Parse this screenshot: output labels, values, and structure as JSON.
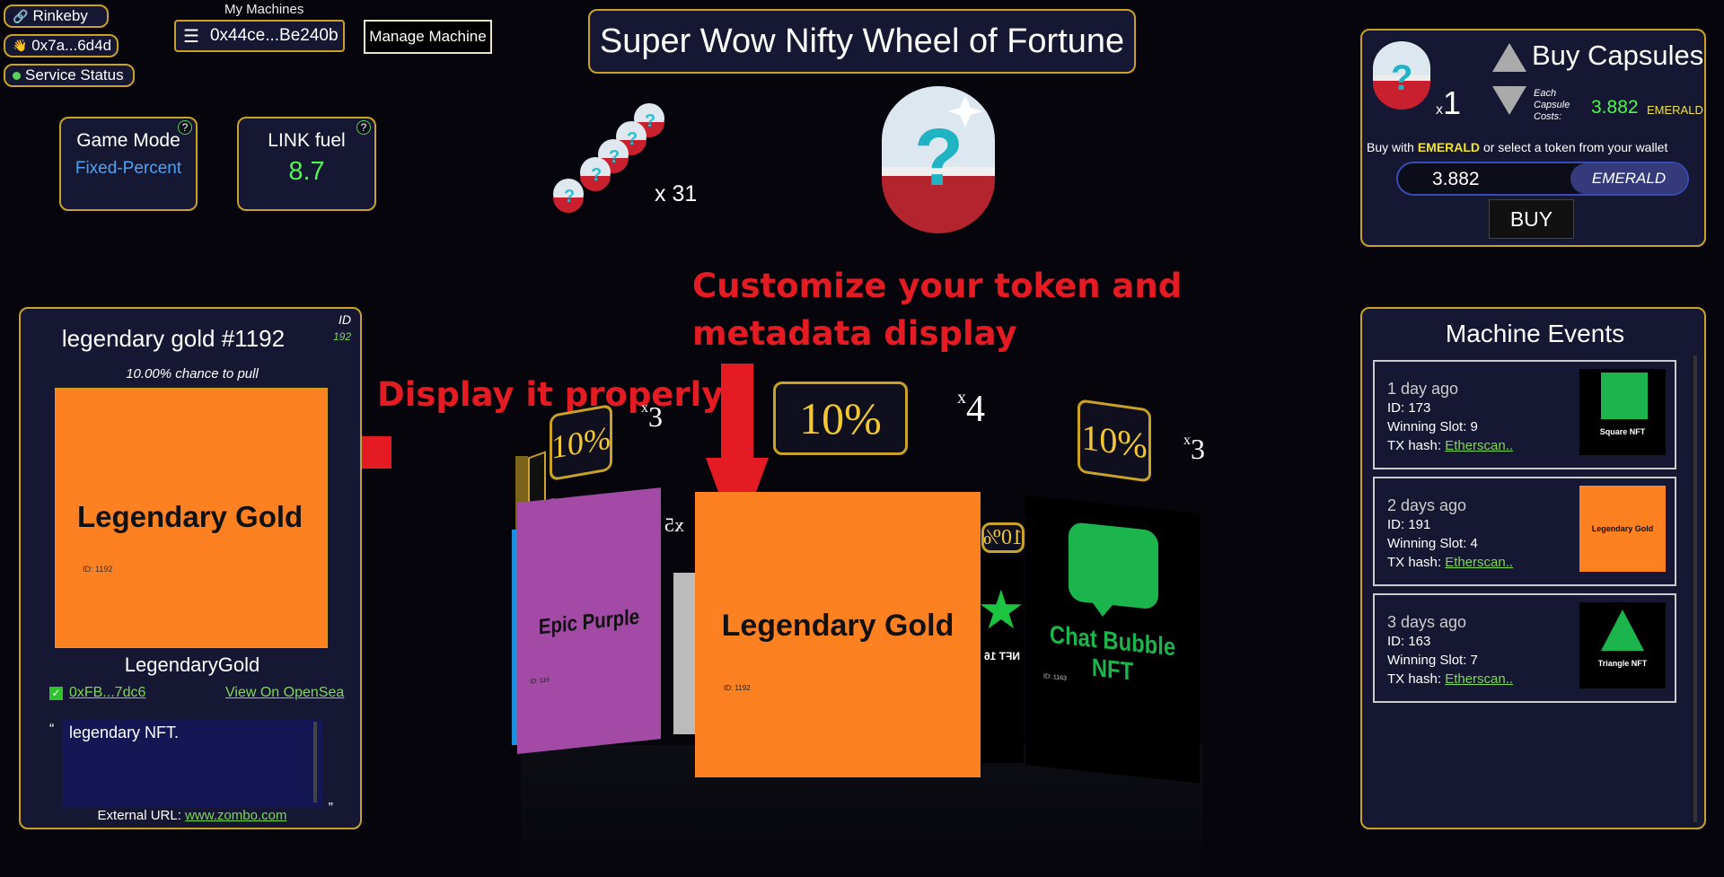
{
  "status": {
    "network": "Rinkeby",
    "wallet": "0x7a...6d4d",
    "service": "Service Status"
  },
  "machines": {
    "caption": "My Machines",
    "selected": "0x44ce...Be240b",
    "manage_label": "Manage Machine"
  },
  "title": "Super Wow Nifty Wheel of Fortune",
  "game_mode": {
    "label": "Game Mode",
    "value": "Fixed-Percent",
    "help": "?"
  },
  "link_fuel": {
    "label": "LINK fuel",
    "value": "8.7",
    "help": "?"
  },
  "capsules_owned": {
    "count": "x 31"
  },
  "annotations": {
    "customize_line1": "Customize your token and",
    "customize_line2": "metadata display",
    "display": "Display it properly!"
  },
  "token_panel": {
    "name": "legendary gold #1192",
    "id_label": "ID",
    "id_value": "192",
    "chance": "10.00% chance to pull",
    "image_title": "Legendary Gold",
    "image_id": "ID: 1192",
    "collection": "LegendaryGold",
    "contract": "0xFB...7dc6",
    "opensea": "View On OpenSea",
    "description": "legendary NFT.",
    "external_label": "External URL:",
    "external_url": "www.zombo.com"
  },
  "wheel": {
    "slots": [
      {
        "percent": "10%",
        "multiplier": "3",
        "title": "Epic Purple",
        "id": "ID: 116"
      },
      {
        "percent": "10%",
        "multiplier": "4",
        "title": "Legendary Gold",
        "id": "ID: 1192"
      },
      {
        "percent": "10%",
        "multiplier": "3",
        "title": "Chat Bubble NFT",
        "id": "ID: 1163"
      }
    ],
    "side_mult_left": "3",
    "side_mult_back": "5",
    "side_pct_right": "10%",
    "star_label": "Star NFT",
    "mult_prefix": "x"
  },
  "buy": {
    "title": "Buy Capsules",
    "quantity": "1",
    "quantity_prefix": "x",
    "cost_caption_1": "Each",
    "cost_caption_2": "Capsule",
    "cost_caption_3": "Costs:",
    "cost_value": "3.882",
    "cost_token": "EMERALD",
    "note_prefix": "Buy with",
    "note_token": "EMERALD",
    "note_suffix": "or select a token from your wallet",
    "amount": "3.882",
    "token_button": "EMERALD",
    "buy_label": "BUY"
  },
  "events": {
    "title": "Machine Events",
    "id_prefix": "ID:",
    "slot_prefix": "Winning Slot:",
    "tx_prefix": "TX hash:",
    "items": [
      {
        "ago": "1 day ago",
        "id": "173",
        "slot": "9",
        "tx": "Etherscan..",
        "thumb": "Square NFT"
      },
      {
        "ago": "2 days ago",
        "id": "191",
        "slot": "4",
        "tx": "Etherscan..",
        "thumb": "Legendary Gold"
      },
      {
        "ago": "3 days ago",
        "id": "163",
        "slot": "7",
        "tx": "Etherscan..",
        "thumb": "Triangle NFT"
      }
    ]
  },
  "colors": {
    "gold_border": "#c9a227",
    "panel_bg": "#151733",
    "accent_green": "#59d35a",
    "annotation_red": "#e51b24",
    "orange": "#fd8120",
    "purple": "#a24aa5"
  },
  "icons": {
    "network": "chain-link-icon",
    "wallet": "hand-wave-icon",
    "service": "status-dot-icon",
    "menu": "hamburger-menu-icon",
    "capsule": "mystery-capsule-icon"
  }
}
